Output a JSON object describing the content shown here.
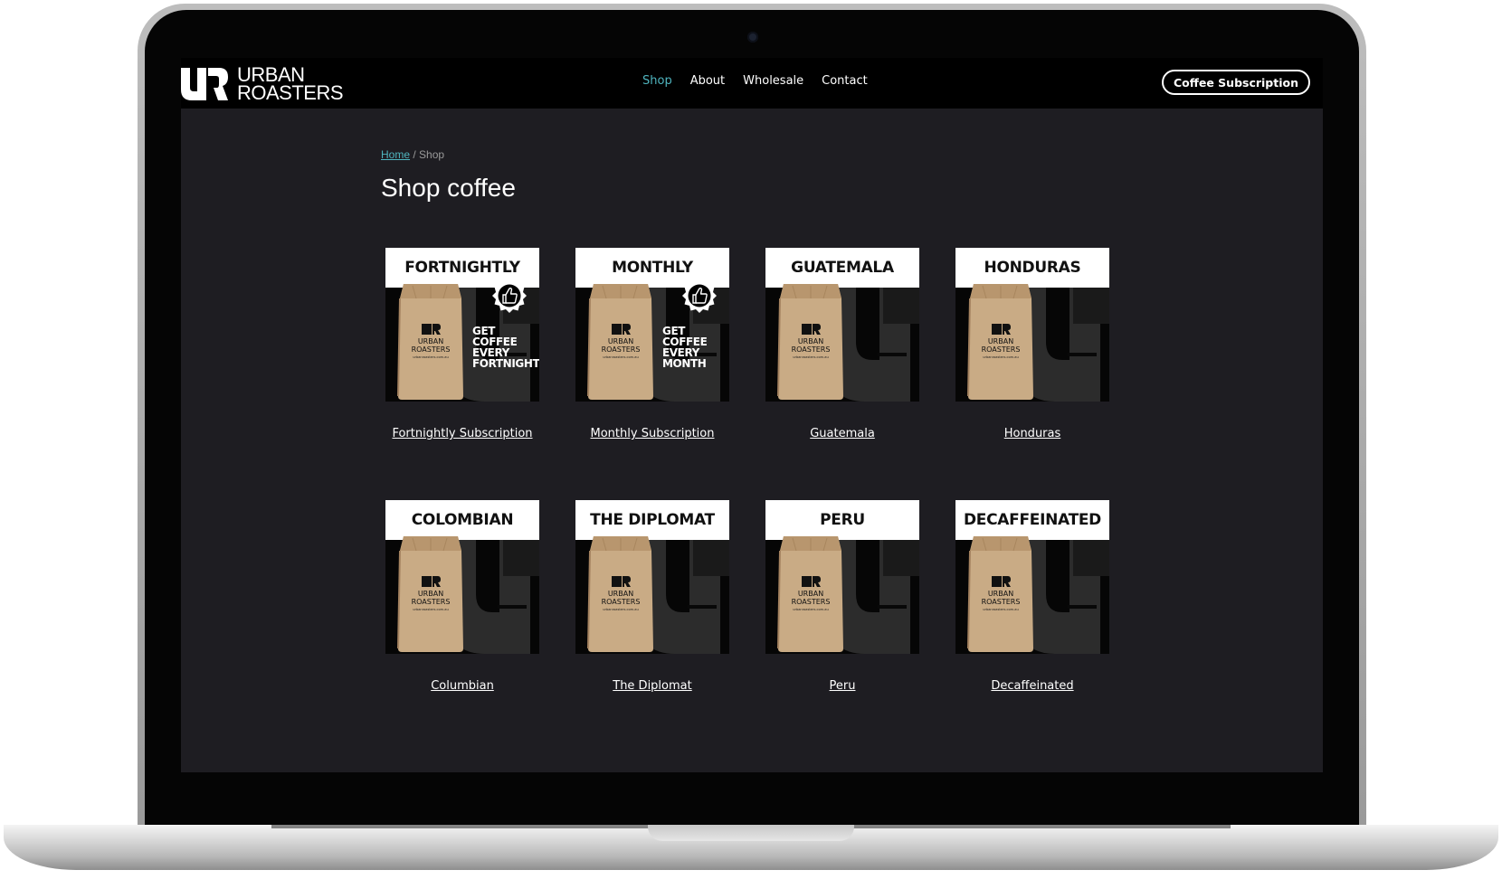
{
  "brand": {
    "line1": "URBAN",
    "line2": "ROASTERS"
  },
  "nav": {
    "items": [
      {
        "label": "Shop",
        "active": true
      },
      {
        "label": "About",
        "active": false
      },
      {
        "label": "Wholesale",
        "active": false
      },
      {
        "label": "Contact",
        "active": false
      }
    ],
    "cta_label": "Coffee Subscription"
  },
  "breadcrumb": {
    "home": "Home",
    "separator": " / ",
    "current": "Shop"
  },
  "page_title": "Shop coffee",
  "products": [
    {
      "heading": "FORTNIGHTLY",
      "link": "Fortnightly Subscription",
      "tagline": [
        "GET",
        "COFFEE",
        "EVERY",
        "FORTNIGHT"
      ],
      "badge": "thumbs-up-icon"
    },
    {
      "heading": "MONTHLY",
      "link": "Monthly Subscription",
      "tagline": [
        "GET",
        "COFFEE",
        "EVERY",
        "MONTH"
      ],
      "badge": "thumbs-up-icon"
    },
    {
      "heading": "GUATEMALA",
      "link": "Guatemala"
    },
    {
      "heading": "HONDURAS",
      "link": "Honduras"
    },
    {
      "heading": "COLOMBIAN",
      "link": "Columbian"
    },
    {
      "heading": "THE DIPLOMAT",
      "link": "The Diplomat"
    },
    {
      "heading": "PERU",
      "link": "Peru"
    },
    {
      "heading": "DECAFFEINATED",
      "link": "Decaffeinated"
    }
  ],
  "bag_label": {
    "line1": "URBAN",
    "line2": "ROASTERS",
    "url": "urbanroasters.com.au"
  },
  "colors": {
    "accent": "#4fb5bf",
    "page_bg": "#1e1d22",
    "nav_bg": "#000000",
    "bag_kraft": "#c9ab85"
  }
}
